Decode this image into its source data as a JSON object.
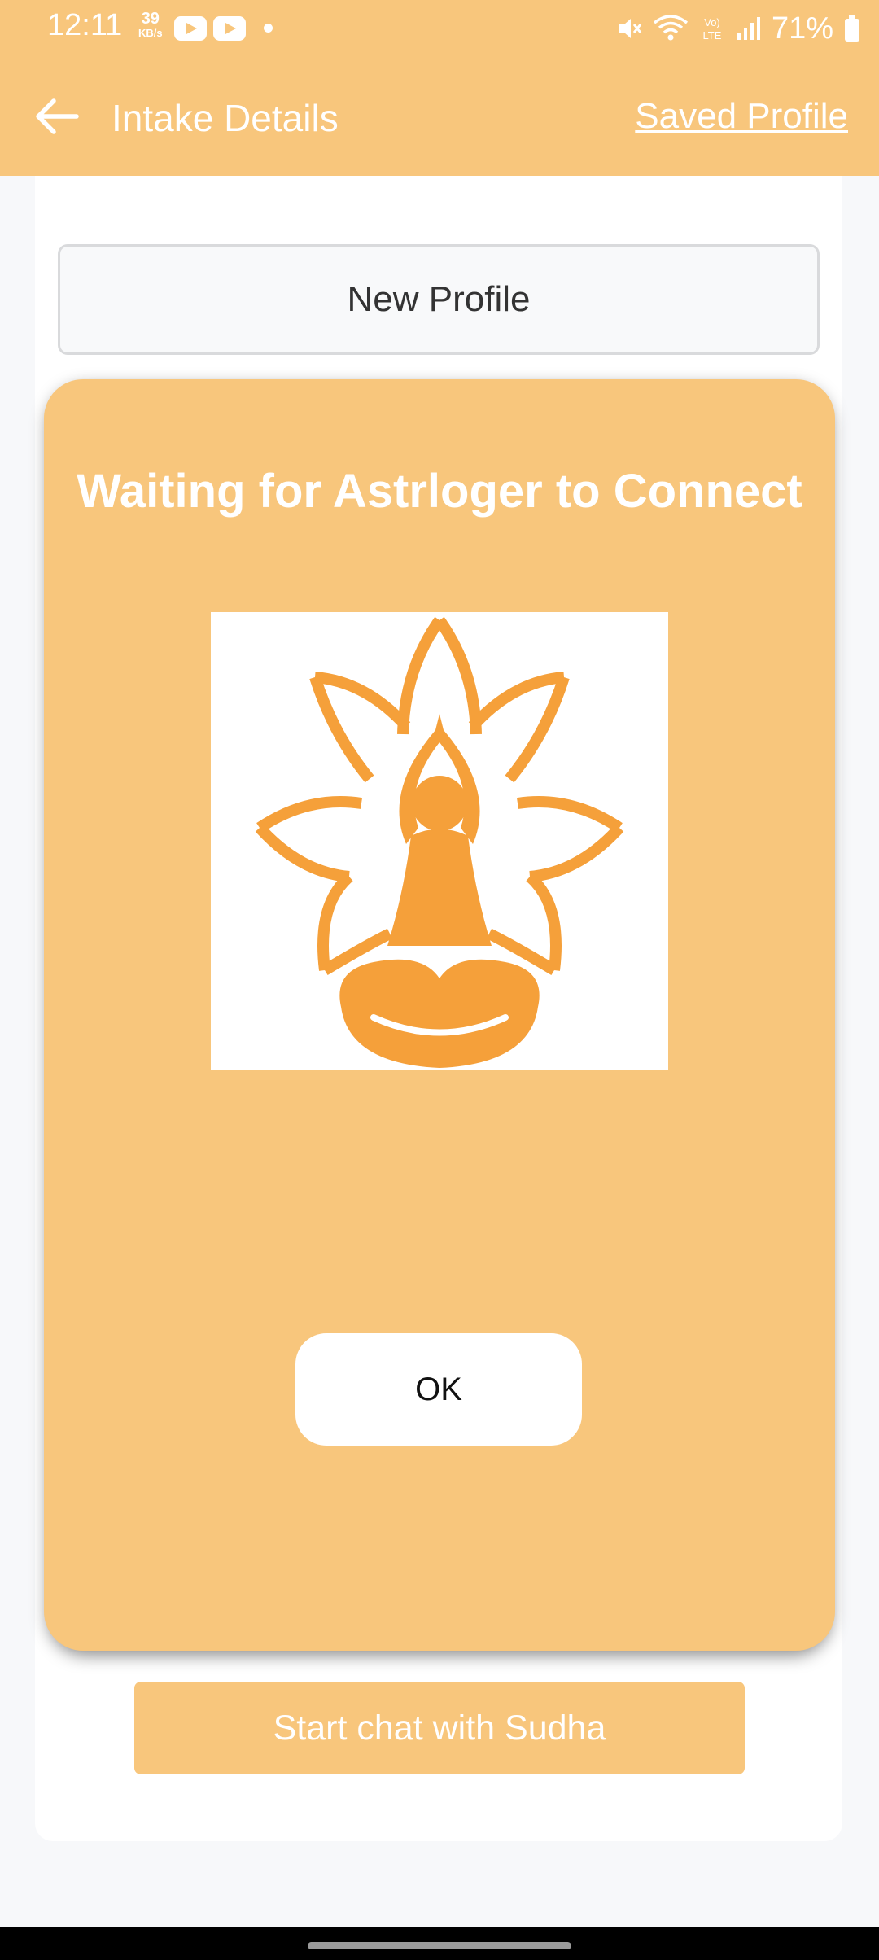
{
  "status_bar": {
    "time": "12:11",
    "speed_value": "39",
    "speed_unit": "KB/s",
    "battery": "71%"
  },
  "app_bar": {
    "title": "Intake Details",
    "saved_profile": "Saved Profile"
  },
  "form": {
    "new_profile": "New Profile",
    "start_chat": "Start chat with Sudha"
  },
  "dialog": {
    "title": "Waiting for Astrloger to Connect",
    "ok": "OK"
  },
  "colors": {
    "accent": "#f8c67c",
    "logo_orange": "#f5a03a"
  }
}
